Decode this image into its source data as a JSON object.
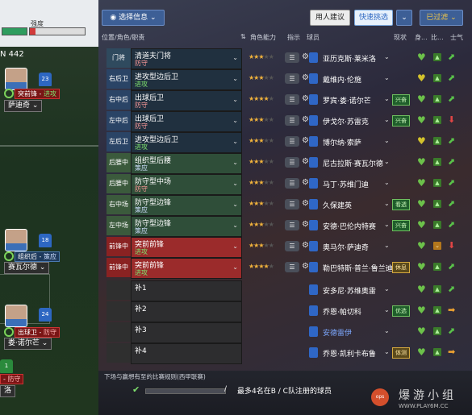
{
  "pitch": {
    "strength_label": "强度",
    "formation": "N 442",
    "players": [
      {
        "number": "23",
        "role": "突前锋",
        "duty": "进攻",
        "name": "萨迪奇"
      },
      {
        "number": "18",
        "role": "组织后",
        "duty": "策应",
        "name": "赛瓦尔德"
      },
      {
        "number": "24",
        "role": "出球卫",
        "duty": "防守",
        "name": "娄·诺尔芒"
      },
      {
        "number": "1",
        "role": "",
        "duty": "防守",
        "name": "洛"
      }
    ]
  },
  "toolbar": {
    "select_info": "选择信息",
    "user_suggest": "用人建议",
    "quick_pick": "快速挑选",
    "filter": "已过滤"
  },
  "headers": {
    "position": "位置/角色/职责",
    "role_ability": "角色能力",
    "instructions": "指示",
    "player": "球员",
    "form": "现状",
    "fitness": "身...",
    "match": "比...",
    "morale": "士气"
  },
  "rows": [
    {
      "pos": "门将",
      "role": "清道夫门将",
      "duty": "防守",
      "duty_type": "a",
      "stars": "★★★",
      "stars_off": "★★",
      "player": "亚历克斯·莱米洛",
      "badge": "",
      "heart": "g",
      "sq": "green",
      "morale": "up"
    },
    {
      "pos": "右后卫",
      "role": "进攻型边后卫",
      "duty": "进攻",
      "duty_type": "d",
      "stars": "★★★",
      "stars_off": "★★",
      "player": "戴维内·伦施",
      "badge": "",
      "heart": "y",
      "sq": "green",
      "morale": "up"
    },
    {
      "pos": "右中后卫",
      "role": "出球后卫",
      "duty": "防守",
      "duty_type": "a",
      "stars": "★★★★",
      "stars_off": "★",
      "player": "罗宾·娄·诺尔芒",
      "badge": "兴奋",
      "heart": "g",
      "sq": "green",
      "morale": "up"
    },
    {
      "pos": "左中后卫",
      "role": "出球后卫",
      "duty": "防守",
      "duty_type": "a",
      "stars": "★★★",
      "stars_off": "★★",
      "player": "伊戈尔·苏雷克",
      "badge": "兴奋",
      "heart": "g",
      "sq": "green",
      "morale": "down"
    },
    {
      "pos": "左后卫",
      "role": "进攻型边后卫",
      "duty": "进攻",
      "duty_type": "d",
      "stars": "★★★",
      "stars_off": "★★",
      "player": "博尔纳·索萨",
      "badge": "",
      "heart": "y",
      "sq": "green",
      "morale": "up"
    },
    {
      "pos": "后腰中后",
      "role": "组织型后腰",
      "duty": "策应",
      "duty_type": "s",
      "stars": "★★★",
      "stars_off": "★★",
      "player": "尼古拉斯·赛瓦尔德",
      "badge": "",
      "heart": "g",
      "sq": "green",
      "morale": "up"
    },
    {
      "pos": "后腰中右",
      "role": "防守型中场",
      "duty": "防守",
      "duty_type": "a",
      "stars": "★★★",
      "stars_off": "★★",
      "player": "马丁·苏维门迪",
      "badge": "",
      "heart": "g",
      "sq": "green",
      "morale": "up"
    },
    {
      "pos": "右中场",
      "role": "防守型边锋",
      "duty": "策应",
      "duty_type": "s",
      "stars": "★★★",
      "stars_off": "★★",
      "player": "久保建英",
      "badge": "看透",
      "heart": "g",
      "sq": "green",
      "morale": "up"
    },
    {
      "pos": "左中场",
      "role": "防守型边锋",
      "duty": "策应",
      "duty_type": "s",
      "stars": "★★★",
      "stars_off": "★★",
      "player": "安德·巴伦内特赛",
      "badge": "兴奋",
      "heart": "g",
      "sq": "green",
      "morale": "up"
    },
    {
      "pos": "前锋中右",
      "role": "突前前锋",
      "duty": "进攻",
      "duty_type": "d",
      "stars": "★★★",
      "stars_off": "★★",
      "player": "奥马尔·萨迪奇",
      "badge": "",
      "heart": "g",
      "sq": "orange",
      "morale": "down"
    },
    {
      "pos": "前锋中左",
      "role": "突前前锋",
      "duty": "进攻",
      "duty_type": "d",
      "stars": "★★★★",
      "stars_off": "★",
      "player": "勒巴特斯·普兰·鲁兰迪",
      "badge": "休息",
      "heart": "g",
      "sq": "green",
      "morale": "up"
    },
    {
      "pos": "",
      "role": "补1",
      "duty": "",
      "duty_type": "s",
      "stars": "",
      "stars_off": "",
      "player": "安多尼·苏维奥雷",
      "badge": "",
      "heart": "g",
      "sq": "green",
      "morale": "up"
    },
    {
      "pos": "",
      "role": "补2",
      "duty": "",
      "duty_type": "s",
      "stars": "",
      "stars_off": "",
      "player": "乔恩·帕切科",
      "badge": "优选",
      "heart": "g",
      "sq": "green",
      "morale": "side"
    },
    {
      "pos": "",
      "role": "补3",
      "duty": "",
      "duty_type": "s",
      "stars": "",
      "stars_off": "",
      "player": "安德雷伊",
      "badge": "",
      "heart": "g",
      "sq": "green",
      "morale": "up"
    },
    {
      "pos": "",
      "role": "补4",
      "duty": "",
      "duty_type": "s",
      "stars": "",
      "stars_off": "",
      "player": "乔恩·凯利卡布鲁",
      "badge": "体测",
      "heart": "g",
      "sq": "green",
      "morale": "side"
    }
  ],
  "bottom": {
    "rules": "下场与赢想有至的比赛规则(西甲联赛)",
    "slash": "/",
    "note": "最多4名在B / C队注册的球员"
  },
  "watermark": {
    "name": "爆游小组",
    "url": "WWW.PLAY6M.CC",
    "logo": "ops"
  },
  "colors": {
    "accent": "#3d5f96",
    "defend": "#7ee06d",
    "attack": "#ff9a9a",
    "star": "#f0b23c"
  }
}
